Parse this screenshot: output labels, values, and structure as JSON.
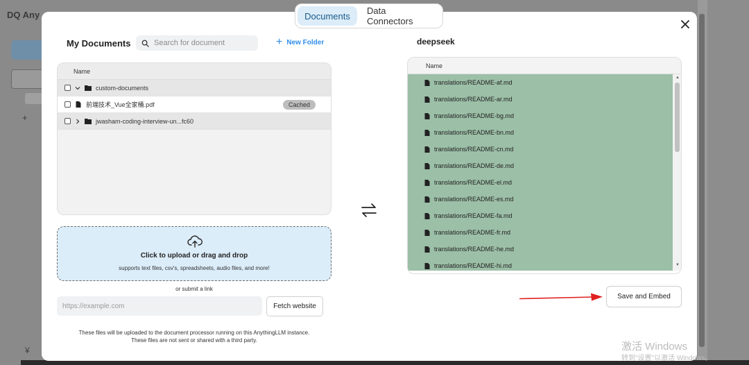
{
  "background_app": {
    "logo": "DQ Any",
    "plus": "+",
    "bottom_glyph": "¥"
  },
  "tabs": [
    {
      "label": "Documents",
      "active": true
    },
    {
      "label": "Data Connectors",
      "active": false
    }
  ],
  "left": {
    "title": "My Documents",
    "search_placeholder": "Search for document",
    "new_folder_label": "New Folder",
    "table_header": "Name",
    "rows": [
      {
        "type": "folder",
        "expanded": true,
        "name": "custom-documents"
      },
      {
        "type": "file",
        "name": "前端技术_Vue全家桶.pdf",
        "badge": "Cached"
      },
      {
        "type": "folder",
        "expanded": false,
        "name": "jwasham-coding-interview-un...fc60"
      }
    ],
    "upload_title": "Click to upload or drag and drop",
    "upload_subtitle": "supports text files, csv's, spreadsheets, audio files, and more!",
    "or_submit_link": "or submit a link",
    "url_placeholder": "https://example.com",
    "fetch_label": "Fetch website",
    "disclaimer_line1": "These files will be uploaded to the document processor running on this AnythingLLM instance.",
    "disclaimer_line2": "These files are not sent or shared with a third party."
  },
  "right": {
    "workspace_title": "deepseek",
    "table_header": "Name",
    "files": [
      "translations/README-af.md",
      "translations/README-ar.md",
      "translations/README-bg.md",
      "translations/README-bn.md",
      "translations/README-cn.md",
      "translations/README-de.md",
      "translations/README-el.md",
      "translations/README-es.md",
      "translations/README-fa.md",
      "translations/README-fr.md",
      "translations/README-he.md",
      "translations/README-hi.md"
    ],
    "save_label": "Save and Embed"
  },
  "watermark": {
    "line1": "激活 Windows",
    "line2": "转到\"设置\"以激活 Windows。"
  },
  "colors": {
    "accent": "#2f8ee6",
    "tab_active_bg": "#dcecf8",
    "dropzone_bg": "#dcedfa",
    "selected_rows": "#9cbfa7",
    "annotation_arrow": "#e02020"
  }
}
